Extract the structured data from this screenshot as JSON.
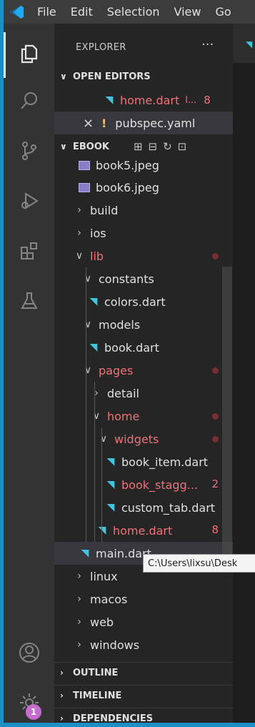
{
  "menubar": {
    "logo_icon": "vscode-logo-icon",
    "items": [
      "File",
      "Edit",
      "Selection",
      "View",
      "Go"
    ]
  },
  "activitybar": {
    "icons": [
      "files-icon",
      "search-icon",
      "source-control-icon",
      "run-debug-icon",
      "extensions-icon",
      "testing-icon",
      "account-icon",
      "settings-gear-icon"
    ],
    "settings_badge": "1"
  },
  "sidebar": {
    "title": "EXPLORER",
    "more": "···",
    "open_editors": {
      "header": "OPEN EDITORS",
      "items": [
        {
          "name": "home.dart",
          "suffix": "l...",
          "count": "8"
        },
        {
          "close": "×",
          "marker": "!",
          "name": "pubspec.yaml"
        }
      ]
    },
    "project": {
      "header": "EBOOK",
      "tree": [
        {
          "label": "book5.jpeg"
        },
        {
          "label": "book6.jpeg"
        },
        {
          "label": "build"
        },
        {
          "label": "ios"
        },
        {
          "label": "lib"
        },
        {
          "label": "constants"
        },
        {
          "label": "colors.dart"
        },
        {
          "label": "models"
        },
        {
          "label": "book.dart"
        },
        {
          "label": "pages"
        },
        {
          "label": "detail"
        },
        {
          "label": "home"
        },
        {
          "label": "widgets"
        },
        {
          "label": "book_item.dart"
        },
        {
          "label": "book_stagg...",
          "count": "2"
        },
        {
          "label": "custom_tab.dart"
        },
        {
          "label": "home.dart",
          "count": "8"
        },
        {
          "label": "main.dart"
        },
        {
          "label": "linux"
        },
        {
          "label": "macos"
        },
        {
          "label": "web"
        },
        {
          "label": "windows"
        }
      ]
    },
    "bottom_sections": [
      "OUTLINE",
      "TIMELINE",
      "DEPENDENCIES"
    ]
  },
  "tooltip": "C:\\Users\\lixsu\\Desk",
  "colors": {
    "frame": "#1d8fc6",
    "error_red": "#f07178",
    "dart_blue": "#40c4e0",
    "badge": "#c66bd0"
  }
}
